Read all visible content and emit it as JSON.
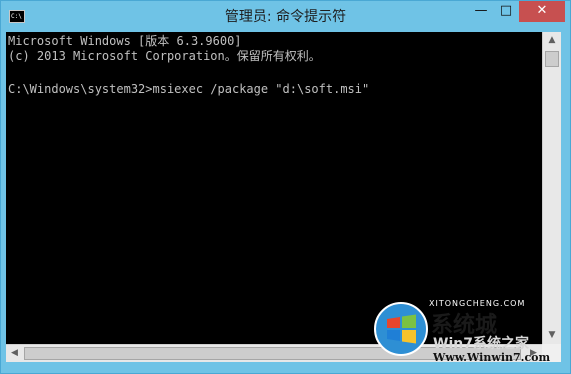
{
  "window": {
    "title": "管理员: 命令提示符",
    "icon_text": "C:\\"
  },
  "controls": {
    "minimize": "—",
    "maximize": "□",
    "close": "✕"
  },
  "console": {
    "lines": [
      "Microsoft Windows [版本 6.3.9600]",
      "(c) 2013 Microsoft Corporation。保留所有权利。",
      "",
      "C:\\Windows\\system32>msiexec /package \"d:\\soft.msi\""
    ]
  },
  "scrollbar": {
    "up": "▲",
    "down": "▼",
    "left": "◀",
    "right": "▶"
  },
  "watermark": {
    "pinyin": "XITONGCHENG.COM",
    "brand": "系统城",
    "sub": "Win7系统之家",
    "url": "Www.Winwin7.com"
  },
  "colors": {
    "console_bg": "#000000",
    "console_text": "#c0c0c0",
    "titlebar": "#6fc3e6",
    "close": "#c75050"
  }
}
